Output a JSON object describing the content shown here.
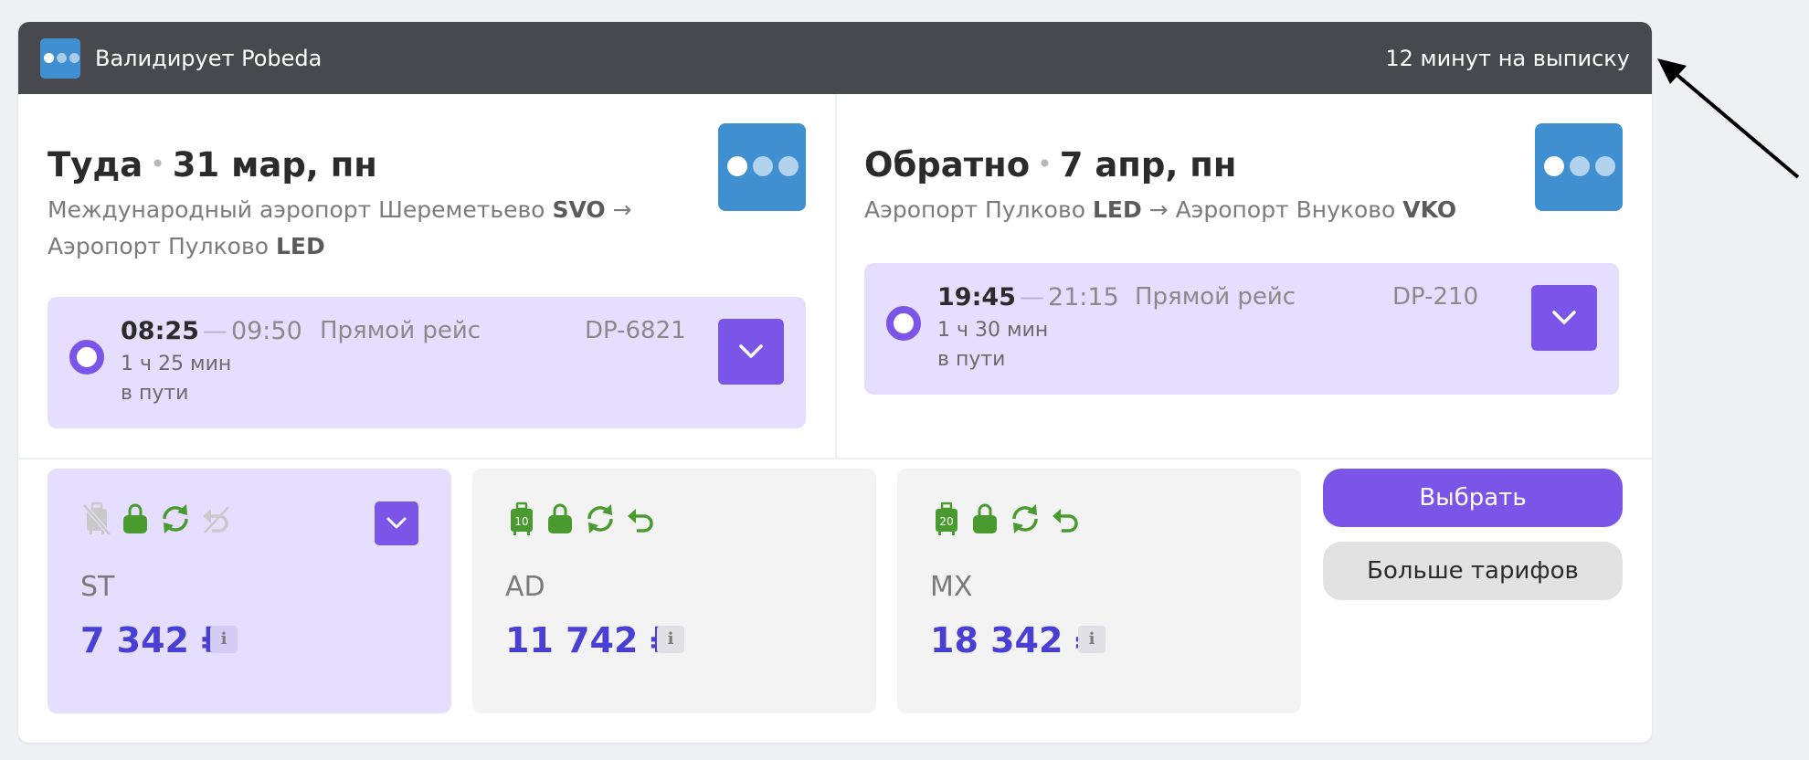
{
  "header": {
    "title": "Валидирует Pobeda",
    "timer_text": "12 минут на выписку",
    "logo_icon": "pobeda-logo-icon"
  },
  "outbound": {
    "direction": "Туда",
    "date": "31 мар, пн",
    "route_from": "Международный аэропорт Шереметьево ",
    "route_from_code": "SVO",
    "route_arrow": " →",
    "route_to": "Аэропорт Пулково ",
    "route_to_code": "LED",
    "departure_time": "08:25",
    "dash": "—",
    "arrival_time": "09:50",
    "duration": "1 ч 25 мин",
    "duration_suffix": "в пути",
    "flight_type": "Прямой рейс",
    "flight_number": "DP-6821"
  },
  "inbound": {
    "direction": "Обратно",
    "date": "7 апр, пн",
    "route_from": "Аэропорт Пулково ",
    "route_from_code": "LED",
    "route_arrow": " → ",
    "route_to": "Аэропорт Внуково ",
    "route_to_code": "VKO",
    "departure_time": "19:45",
    "dash": "—",
    "arrival_time": "21:15",
    "duration": "1 ч 30 мин",
    "duration_suffix": "в пути",
    "flight_type": "Прямой рейс",
    "flight_number": "DP-210"
  },
  "tariffs": [
    {
      "code": "ST",
      "price": "7 342 ₽",
      "info": "i",
      "selected": true,
      "baggage_kg": ""
    },
    {
      "code": "AD",
      "price": "11 742 ₽",
      "info": "i",
      "selected": false,
      "baggage_kg": "10"
    },
    {
      "code": "MX",
      "price": "18 342 ₽",
      "info": "i",
      "selected": false,
      "baggage_kg": "20"
    }
  ],
  "actions": {
    "select_label": "Выбрать",
    "more_tariffs_label": "Больше тарифов"
  },
  "colors": {
    "accent": "#7b55e8",
    "price": "#4a3fd4",
    "header_bg": "#47494e",
    "airline_logo": "#3f8fd1",
    "selected_bg": "#e5defe",
    "icon_green": "#4a9b2f",
    "icon_disabled": "#c9c9c9"
  }
}
